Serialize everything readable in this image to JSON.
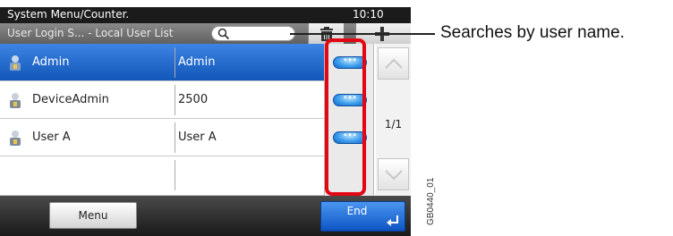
{
  "status_bar": {
    "title": "System Menu/Counter.",
    "time": "10:10"
  },
  "title_bar": {
    "breadcrumb": "User Login S... - Local User List",
    "search_icon": "search-icon",
    "trash_icon": "trash-icon",
    "add_icon": "plus-icon"
  },
  "user_list": {
    "rows": [
      {
        "login_name": "Admin",
        "user_name": "Admin",
        "selected": true
      },
      {
        "login_name": "DeviceAdmin",
        "user_name": "2500",
        "selected": false
      },
      {
        "login_name": "User A",
        "user_name": "User A",
        "selected": false
      },
      {
        "login_name": "",
        "user_name": "",
        "selected": false
      }
    ],
    "detail_button_glyph": "•••"
  },
  "scroll": {
    "page": "1/1"
  },
  "bottom_bar": {
    "menu_label": "Menu",
    "end_label": "End"
  },
  "annotation": {
    "callout_text": "Searches by user name.",
    "highlight_color": "#e30613",
    "figure_id": "GB0440_01"
  },
  "colors": {
    "selected_row": "#1f6fd4",
    "end_button": "#1a6fe0",
    "header": "#1b1b1b"
  }
}
